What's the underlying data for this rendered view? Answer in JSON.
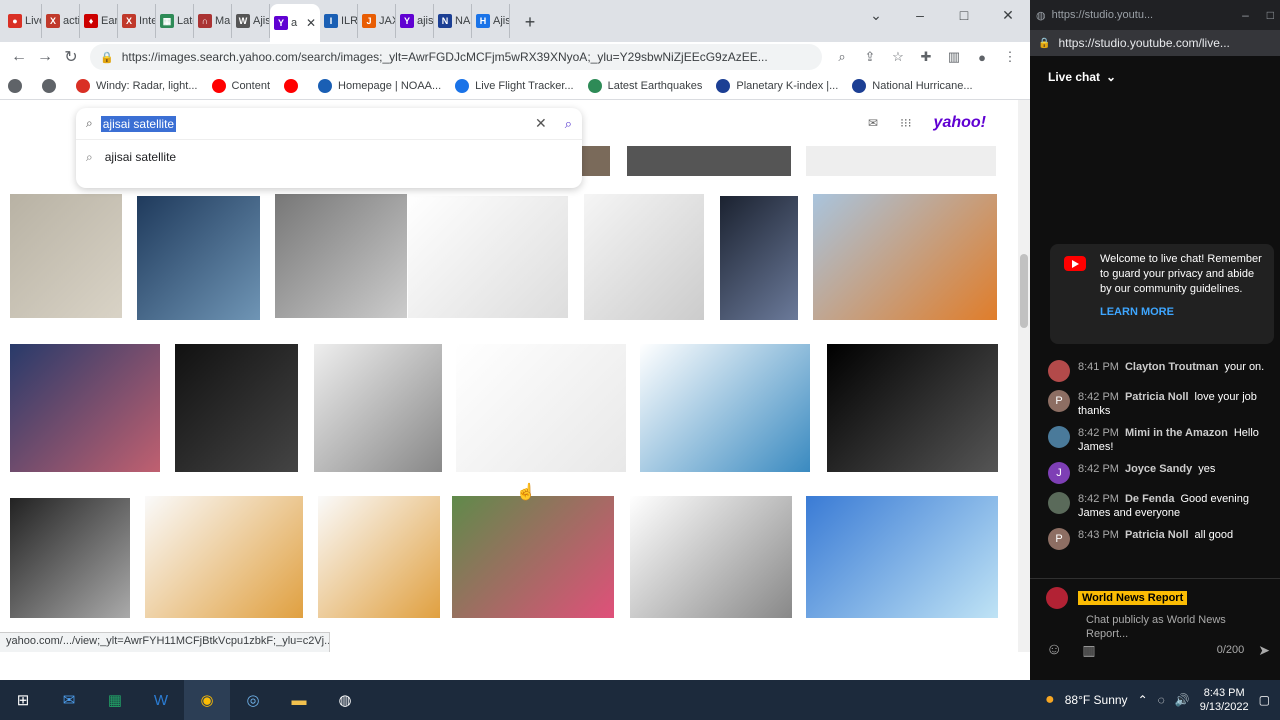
{
  "browser": {
    "tabs": [
      {
        "label": "Live",
        "color": "#d93025",
        "letter": "●"
      },
      {
        "label": "acti",
        "color": "#c0392b",
        "letter": "X"
      },
      {
        "label": "Eart",
        "color": "#cc0000",
        "letter": "♦"
      },
      {
        "label": "Inte",
        "color": "#c0392b",
        "letter": "X"
      },
      {
        "label": "Late",
        "color": "#2e8b57",
        "letter": "▦"
      },
      {
        "label": "Mar",
        "color": "#a33",
        "letter": "∩"
      },
      {
        "label": "Ajis",
        "color": "#555",
        "letter": "W"
      },
      {
        "label": "a",
        "color": "#6001d2",
        "letter": "Y",
        "active": true
      },
      {
        "label": "ILRS",
        "color": "#1a5fb4",
        "letter": "I"
      },
      {
        "label": "JAX",
        "color": "#e85d04",
        "letter": "J"
      },
      {
        "label": "ajisi",
        "color": "#6001d2",
        "letter": "Y"
      },
      {
        "label": "NAS",
        "color": "#1c3f94",
        "letter": "N"
      },
      {
        "label": "Ajis",
        "color": "#1a73e8",
        "letter": "H"
      }
    ],
    "new_tab": "+",
    "url": "https://images.search.yahoo.com/search/images;_ylt=AwrFGDJcMCFjm5wRX39XNyoA;_ylu=Y29sbwNiZjEEcG9zAzEE...",
    "bookmarks": [
      {
        "label": "",
        "color": "#5f6368"
      },
      {
        "label": "",
        "color": "#5f6368"
      },
      {
        "label": "Windy: Radar, light...",
        "color": "#d93025"
      },
      {
        "label": "Content",
        "color": "#ff0000"
      },
      {
        "label": "",
        "color": "#ff0000"
      },
      {
        "label": "Homepage | NOAA...",
        "color": "#1a5fb4"
      },
      {
        "label": "Live Flight Tracker...",
        "color": "#1a73e8"
      },
      {
        "label": "Latest Earthquakes",
        "color": "#2e8b57"
      },
      {
        "label": "Planetary K-index |...",
        "color": "#1c3f94"
      },
      {
        "label": "National Hurricane...",
        "color": "#1c3f94"
      }
    ]
  },
  "search": {
    "query": "ajisai satellite",
    "suggestion": "ajisai satellite",
    "logo": "yahoo!"
  },
  "status_url": "yahoo.com/.../view;_ylt=AwrFYH11MCFjBtkVcpu1zbkF;_ylu=c2Vj...",
  "image_tiles": [
    {
      "name": "satellite-illustration",
      "c1": "#b8b2a4",
      "c2": "#d9d3c6"
    },
    {
      "name": "earth-globe",
      "c1": "#1f3a5c",
      "c2": "#6f95b5"
    },
    {
      "name": "ajisai-lab-photo",
      "c1": "#777",
      "c2": "#ccc"
    },
    {
      "name": "dot-plot-chart",
      "c1": "#fff",
      "c2": "#ddd"
    },
    {
      "name": "3d-surface-plot",
      "c1": "#f5f5f5",
      "c2": "#ccc"
    },
    {
      "name": "satellite-in-orbit",
      "c1": "#1b2230",
      "c2": "#6b7a9a"
    },
    {
      "name": "ship-photo",
      "c1": "#a9c4dd",
      "c2": "#e07d2a"
    },
    {
      "name": "observatory-dusk",
      "c1": "#283a6a",
      "c2": "#c06070"
    },
    {
      "name": "laser-beam-night",
      "c1": "#111",
      "c2": "#444"
    },
    {
      "name": "reflector-sphere-closeup",
      "c1": "#eee",
      "c2": "#888"
    },
    {
      "name": "line-charts-grid",
      "c1": "#fff",
      "c2": "#e8e8e8"
    },
    {
      "name": "signal-band-chart",
      "c1": "#fff",
      "c2": "#3a8ac0"
    },
    {
      "name": "satellite-black-space",
      "c1": "#000",
      "c2": "#555"
    },
    {
      "name": "ajisai-sphere",
      "c1": "#222",
      "c2": "#aaa"
    },
    {
      "name": "ajisai-diagram-1",
      "c1": "#fafafa",
      "c2": "#e0a040"
    },
    {
      "name": "ajisai-diagram-2",
      "c1": "#fafafa",
      "c2": "#e0a040"
    },
    {
      "name": "hydrangea-flowers",
      "c1": "#5f8a4a",
      "c2": "#e0507a"
    },
    {
      "name": "satellite-constellation-sample",
      "c1": "#fff",
      "c2": "#888"
    },
    {
      "name": "ais-sds4-diagram",
      "c1": "#3a7bd5",
      "c2": "#bfe3f5"
    }
  ],
  "yt": {
    "title_url": "https://studio.youtu...",
    "url": "https://studio.youtube.com/live...",
    "live_chat_label": "Live chat",
    "welcome_text": "Welcome to live chat! Remember to guard your privacy and abide by our community guidelines.",
    "learn_more": "LEARN MORE",
    "messages": [
      {
        "time": "8:41 PM",
        "author": "Clayton Troutman",
        "text": "your on.",
        "avatar_color": "#b34a4a",
        "initial": ""
      },
      {
        "time": "8:42 PM",
        "author": "Patricia Noll",
        "text": "love your job thanks",
        "avatar_color": "#8d6e63",
        "initial": "P"
      },
      {
        "time": "8:42 PM",
        "author": "Mimi in the Amazon",
        "text": "Hello James!",
        "avatar_color": "#4a7a9a",
        "initial": ""
      },
      {
        "time": "8:42 PM",
        "author": "Joyce Sandy",
        "text": "yes",
        "avatar_color": "#7e3fb5",
        "initial": "J"
      },
      {
        "time": "8:42 PM",
        "author": "De Fenda",
        "text": "Good evening James and everyone",
        "avatar_color": "#5a6a5a",
        "initial": ""
      },
      {
        "time": "8:43 PM",
        "author": "Patricia Noll",
        "text": "all good",
        "avatar_color": "#8d6e63",
        "initial": "P"
      }
    ],
    "composer_name": "World News Report",
    "composer_placeholder": "Chat publicly as World News Report...",
    "char_count": "0/200"
  },
  "taskbar": {
    "weather": "88°F  Sunny",
    "time": "8:43 PM",
    "date": "9/13/2022"
  }
}
